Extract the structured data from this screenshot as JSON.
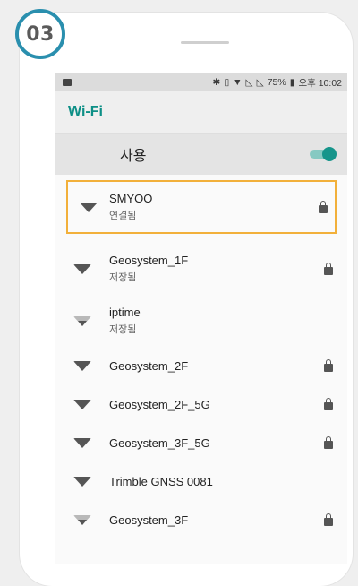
{
  "step": {
    "number": "03",
    "color": "#2a8fae"
  },
  "status_bar": {
    "icons": [
      "image-icon",
      "bluetooth-icon",
      "vibrate-icon",
      "wifi-icon",
      "no-signal-icon",
      "no-signal-icon",
      "battery-icon"
    ],
    "battery": "75%",
    "time": "오후 10:02"
  },
  "appbar": {
    "title": "Wi-Fi",
    "title_color": "#0d8f86"
  },
  "toggle": {
    "label": "사용",
    "state": "on"
  },
  "networks": [
    {
      "ssid": "SMYOO",
      "status": "연결됨",
      "signal": "strong",
      "locked": true,
      "highlighted": true
    },
    {
      "ssid": "Geosystem_1F",
      "status": "저장됨",
      "signal": "strong",
      "locked": true
    },
    {
      "ssid": "iptime",
      "status": "저장됨",
      "signal": "weak",
      "locked": false
    },
    {
      "ssid": "Geosystem_2F",
      "status": "",
      "signal": "strong",
      "locked": true
    },
    {
      "ssid": "Geosystem_2F_5G",
      "status": "",
      "signal": "strong",
      "locked": true
    },
    {
      "ssid": "Geosystem_3F_5G",
      "status": "",
      "signal": "strong",
      "locked": true
    },
    {
      "ssid": "Trimble GNSS 0081",
      "status": "",
      "signal": "strong",
      "locked": false
    },
    {
      "ssid": "Geosystem_3F",
      "status": "",
      "signal": "weak",
      "locked": true
    }
  ],
  "highlight_color": "#f2b03a"
}
